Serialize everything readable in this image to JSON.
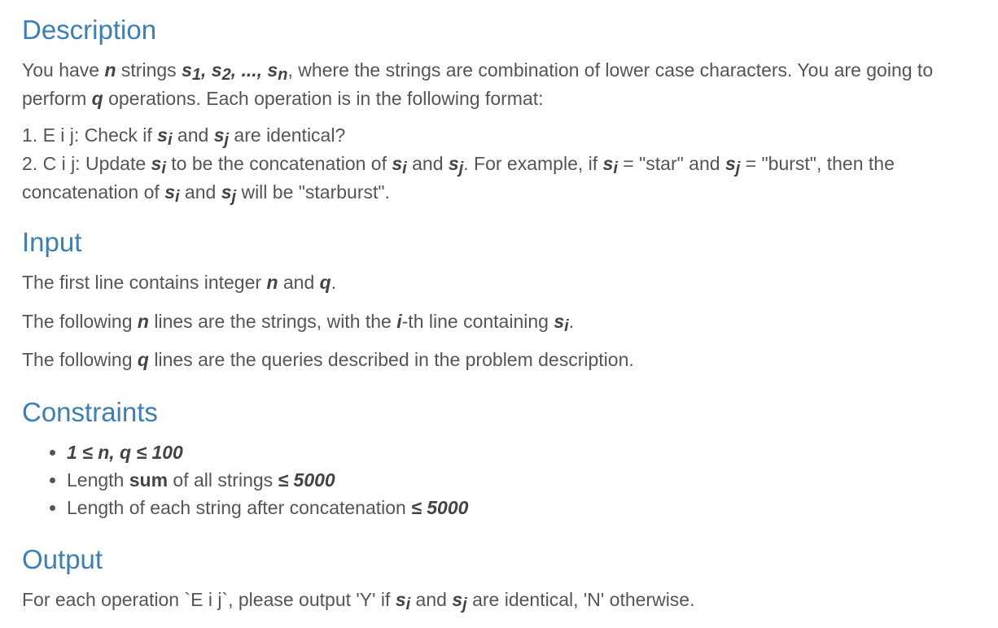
{
  "description": {
    "heading": "Description",
    "intro_1": "You have ",
    "intro_n": "n",
    "intro_2": " strings ",
    "intro_s1": "s",
    "intro_s1_sub": "1",
    "intro_comma1": ", ",
    "intro_s2": "s",
    "intro_s2_sub": "2",
    "intro_dots": ", ..., ",
    "intro_sn": "s",
    "intro_sn_sub": "n",
    "intro_3": ", where the strings are combination of lower case characters.  You are going to perform ",
    "intro_q": "q",
    "intro_4": " operations.  Each operation is in the following format:",
    "op1_prefix": "1. E i j: Check if ",
    "op1_si": "s",
    "op1_si_sub": "i",
    "op1_and": " and ",
    "op1_sj": "s",
    "op1_sj_sub": "j",
    "op1_suffix": " are identical?",
    "op2_prefix": "2. C i j: Update ",
    "op2_si": "s",
    "op2_si_sub": "i",
    "op2_mid1": " to be the concatenation of ",
    "op2_si2": "s",
    "op2_si2_sub": "i",
    "op2_and": " and ",
    "op2_sj": "s",
    "op2_sj_sub": "j",
    "op2_mid2": ".  For example, if ",
    "op2_si3": "s",
    "op2_si3_sub": "i",
    "op2_eq1": " =  \"star\" and ",
    "op2_sj2": "s",
    "op2_sj2_sub": "j",
    "op2_eq2": " = \"burst\", then the concatenation of ",
    "op2_si4": "s",
    "op2_si4_sub": "i",
    "op2_and2": " and ",
    "op2_sj3": "s",
    "op2_sj3_sub": "j",
    "op2_suffix": " will be \"starburst\"."
  },
  "input": {
    "heading": "Input",
    "line1_a": "The first line contains integer ",
    "line1_n": "n",
    "line1_b": " and ",
    "line1_q": "q",
    "line1_c": ".",
    "line2_a": "The following ",
    "line2_n": "n",
    "line2_b": " lines are the strings, with the ",
    "line2_i": "i",
    "line2_c": "-th line containing ",
    "line2_s": "s",
    "line2_s_sub": "i",
    "line2_d": ".",
    "line3_a": "The following ",
    "line3_q": "q",
    "line3_b": " lines are the queries described in the problem description."
  },
  "constraints": {
    "heading": "Constraints",
    "c1": "1 ≤ n, q ≤ 100",
    "c2_a": "Length ",
    "c2_sum": "sum",
    "c2_b": " of all strings ",
    "c2_val": "≤ 5000",
    "c3_a": "Length of each string after concatenation ",
    "c3_val": "≤ 5000"
  },
  "output": {
    "heading": "Output",
    "line_a": "For each operation `E i j`, please output 'Y' if ",
    "line_si": "s",
    "line_si_sub": "i",
    "line_and": " and ",
    "line_sj": "s",
    "line_sj_sub": "j",
    "line_b": " are identical, 'N' otherwise."
  }
}
